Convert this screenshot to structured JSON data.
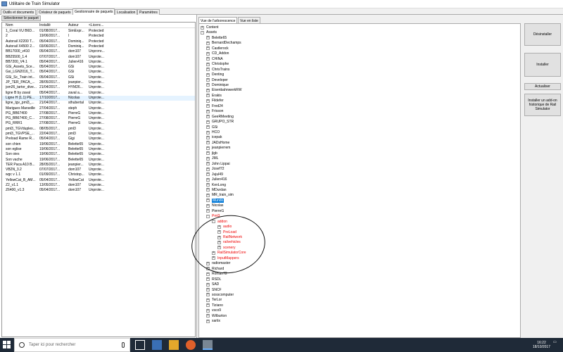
{
  "window": {
    "title": "Utilitaire de Train Simulator"
  },
  "tabs": [
    "Outils et documents",
    "Créateur de paquets",
    "Gestionnaire de paquets",
    "Localisation",
    "Paramètres"
  ],
  "left": {
    "select_button": "Sélectionner le paquet",
    "columns": [
      "Nom",
      "Installé",
      "Auteur",
      "<Licenc..."
    ],
    "rows": [
      [
        "1_Coral VU B6D...",
        "01/08/2017...",
        "SimExpr...",
        "Protected"
      ],
      [
        "2",
        "19/06/2017...",
        "l",
        "Protected"
      ],
      [
        "Autorail X2200 T...",
        "05/04/2017...",
        "Dominiq...",
        "Protected"
      ],
      [
        "Autorail X4500 2...",
        "03/06/2017...",
        "Dominiq...",
        "Protected"
      ],
      [
        "BB17000_v410",
        "05/04/2017...",
        "dom107",
        "Unproте..."
      ],
      [
        "BB25500_1.4",
        "07/07/2017...",
        "dom107",
        "Unprote..."
      ],
      [
        "BB7200_V4.1",
        "05/04/2017...",
        "Julien416",
        "Unprote..."
      ],
      [
        "GSi_Assets_Sce...",
        "05/04/2017...",
        "GSi",
        "Unprote..."
      ],
      [
        "Gsi_LGN2016_T...",
        "05/04/2017...",
        "GSi",
        "Unprote..."
      ],
      [
        "GSi_Sc_Train int...",
        "05/04/2017...",
        "GSi",
        "Unprote..."
      ],
      [
        "JP_TER_PACA_...",
        "28/05/2017...",
        "jeanpier...",
        "Unprote..."
      ],
      [
        "jsm26_tartor_dive...",
        "21/04/2017...",
        "HYM26...",
        "Unprote..."
      ],
      [
        "ligne B by zaval",
        "05/04/2017...",
        "zaval a...",
        "Unprote..."
      ],
      [
        "Ligne H (1.1) PE...",
        "17/10/2017...",
        "Nicolas",
        "Unprote..."
      ],
      [
        "ligne_tgv_pml3_...",
        "21/04/2017...",
        "sthubertal",
        "Unprote..."
      ],
      [
        "Marigues Marseille",
        "27/04/2017...",
        "steph",
        "Unprote..."
      ],
      [
        "PG_BB67400",
        "27/08/2017...",
        "PierreG",
        "Unprote..."
      ],
      [
        "PG_BB67400_C...",
        "27/08/2017...",
        "PierreG",
        "Unprote..."
      ],
      [
        "PG_RRR1",
        "27/08/2017...",
        "PierreG",
        "Unprote..."
      ],
      [
        "pml3_TGVduplex...",
        "08/05/2017...",
        "pml3",
        "Unprote..."
      ],
      [
        "pml3_TGVPSE_...",
        "22/04/2017...",
        "pml3",
        "Unprote..."
      ],
      [
        "Preload Rame R...",
        "05/04/2017...",
        "Gigi",
        "Unprote..."
      ],
      [
        "son chien",
        "19/06/2017...",
        "Belette65",
        "Unprote..."
      ],
      [
        "son eglise",
        "19/06/2017...",
        "Belette65",
        "Unprote..."
      ],
      [
        "Son oies",
        "19/06/2017...",
        "Belette65",
        "Unprote..."
      ],
      [
        "Son vache",
        "19/06/2017...",
        "Belette65",
        "Unprote..."
      ],
      [
        "TER Paca A10 B...",
        "28/05/2017...",
        "jeanpier...",
        "Unprote..."
      ],
      [
        "VB2N_3.2",
        "07/07/2017...",
        "dom107",
        "Unprote..."
      ],
      [
        "wgc v 1.1",
        "01/09/2017...",
        "Christop...",
        "Unprote..."
      ],
      [
        "YellowCat_B_AM...",
        "05/04/2017...",
        "YellowCat",
        "Unprote..."
      ],
      [
        "Z2_v1.1",
        "13/05/2017...",
        "dom107",
        "Unprote..."
      ],
      [
        "Z6400_v1.3",
        "05/04/2017...",
        "dom107",
        "Unprote..."
      ]
    ]
  },
  "right_tabs": [
    "Vue de l'arborescence",
    "Vue en liste"
  ],
  "tree": {
    "content": "Content",
    "assets": "Assets",
    "items": [
      "Belette65",
      "BernardDechamps",
      "Castlerock",
      "CD_Addon",
      "CHINA",
      "Christophe",
      "ChrisTrains",
      "Denting",
      "Developer",
      "Dominique",
      "EisenbahnwerkRW",
      "Erakis",
      "Fildefer",
      "Fred24",
      "Frisson",
      "GeeRMeeting",
      "GRUPO_STR",
      "GSi",
      "HCO",
      "icepak",
      "JADsHome",
      "jeanpierrem",
      "jlgb",
      "JML",
      "John Lippai",
      "Josef72",
      "Jujul49",
      "Julien416",
      "KenLong",
      "MDurdan",
      "MR_train_sim"
    ],
    "selected": "Mundo",
    "after_sel": [
      "Nicolas",
      "PierreG"
    ],
    "pml3": "Pml3",
    "addon": "addon",
    "addon_children": [
      "audio",
      "PreLoad",
      "RailNetwork",
      "railvehicles",
      "scenery"
    ],
    "rsc": "RailSimulatorCore",
    "inputmappers": "InputMappers",
    "tail": [
      "radiomaster",
      "Richard",
      "Roman72",
      "RSDL",
      "SAD",
      "SNCF",
      "sosscomputer",
      "TerLor",
      "Tiziano",
      "vsco9",
      "Wilburton",
      "xartix"
    ]
  },
  "buttons": {
    "uninstall": "Désinstaller",
    "install": "Installer",
    "refresh": "Actualiser",
    "history": "Installer un add-on historique de Rail Simulator"
  },
  "taskbar": {
    "search_placeholder": "Taper ici pour rechercher",
    "time": "16:22",
    "date": "18/10/2017"
  }
}
